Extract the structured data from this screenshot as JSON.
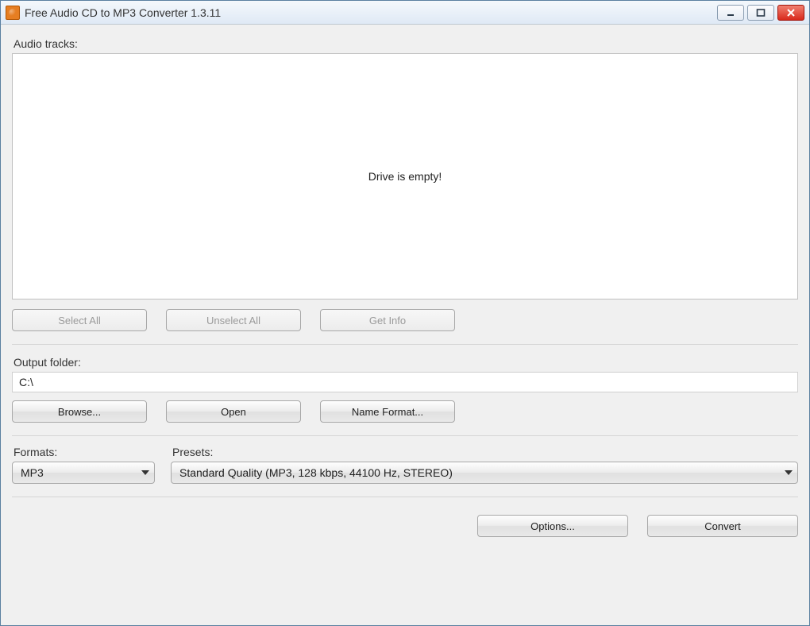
{
  "window": {
    "title": "Free Audio CD to MP3 Converter 1.3.11"
  },
  "tracks": {
    "label": "Audio tracks:",
    "empty_message": "Drive is empty!",
    "buttons": {
      "select_all": "Select All",
      "unselect_all": "Unselect All",
      "get_info": "Get Info"
    }
  },
  "output": {
    "label": "Output folder:",
    "path": "C:\\",
    "buttons": {
      "browse": "Browse...",
      "open": "Open",
      "name_format": "Name Format..."
    }
  },
  "formats": {
    "label": "Formats:",
    "selected": "MP3"
  },
  "presets": {
    "label": "Presets:",
    "selected": "Standard Quality (MP3, 128 kbps, 44100 Hz, STEREO)"
  },
  "footer": {
    "options": "Options...",
    "convert": "Convert"
  }
}
